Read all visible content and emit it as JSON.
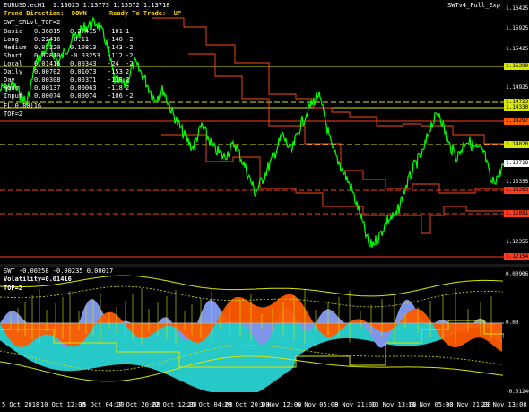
{
  "price_chart": {
    "title": "EURUSD.ecH1  1.13625 1.13773 1.13572 1.13718",
    "trend_direction": "Trend Direction:  DOWN   |  Ready To Trade:  UP",
    "model_label": "SWT_SRLvl_TOF=2",
    "indicator_tag": "SWTv4_Full_Exp",
    "extra_labels": [
      "FL(0.80)16",
      "TOF=2"
    ],
    "stats": [
      {
        "name": "Basic",
        "v1": "0.36815",
        "v2": "0.37415",
        "v3": "-101",
        "v4": "1"
      },
      {
        "name": "Long",
        "v1": "0.22416",
        "v2": "-0.11",
        "v3": "-148",
        "v4": "-2"
      },
      {
        "name": "Medium",
        "v1": "0.07220",
        "v2": "0.10813",
        "v3": "-143",
        "v4": "-2"
      },
      {
        "name": "Short",
        "v1": "0.02810",
        "v2": "-0.03253",
        "v3": "-112",
        "v4": "-2"
      },
      {
        "name": "Local",
        "v1": "0.01416",
        "v2": "0.00343",
        "v3": "-24",
        "v4": "-2"
      },
      {
        "name": "Daily",
        "v1": "0.00702",
        "v2": "0.01073",
        "v3": "-153",
        "v4": "2"
      },
      {
        "name": "Day",
        "v1": "0.00308",
        "v2": "0.00371",
        "v3": "-128",
        "v4": "2"
      },
      {
        "name": "Hour",
        "v1": "0.00137",
        "v2": "0.00063",
        "v3": "-118",
        "v4": "2"
      },
      {
        "name": "Input",
        "v1": "0.00074",
        "v2": "0.00074",
        "v3": "-106",
        "v4": "-2"
      }
    ],
    "scale_labels": [
      {
        "text": "1.16425",
        "style": "plain"
      },
      {
        "text": "1.15925",
        "style": "plain"
      },
      {
        "text": "1.15425",
        "style": "plain"
      },
      {
        "text": "1.15290",
        "style": "box",
        "color": "#d8e600"
      },
      {
        "text": "1.14925",
        "style": "plain"
      },
      {
        "text": "1.14723",
        "style": "box",
        "color": "#d8e600"
      },
      {
        "text": "1.14330",
        "style": "box",
        "color": "#d8e600"
      },
      {
        "text": "1.14297",
        "style": "box",
        "color": "#ff5a00"
      },
      {
        "text": "1.14020",
        "style": "box",
        "color": "#d8e600"
      },
      {
        "text": "1.13718",
        "style": "box",
        "color": "#ffffff"
      },
      {
        "text": "1.13355",
        "style": "plain"
      },
      {
        "text": "1.13263",
        "style": "box",
        "color": "#ff3b1f"
      },
      {
        "text": "1.12881",
        "style": "box",
        "color": "#ff3b1f"
      },
      {
        "text": "1.12355",
        "style": "plain"
      },
      {
        "text": "1.12154",
        "style": "box",
        "color": "#ff3b1f"
      }
    ]
  },
  "indicator_pane": {
    "title": "SWT -0.00258 -0.00235 0.00017",
    "volatility": "Volatility=0.01416",
    "tof": "TOF=2",
    "scale_labels": [
      "0.00906",
      "0.00",
      "-0.01246"
    ]
  },
  "time_axis": [
    "5 Oct 2018",
    "10 Oct 12:00",
    "15 Oct 04:00",
    "17 Oct 20:00",
    "22 Oct 12:00",
    "25 Oct 04:00",
    "29 Oct 20:00",
    "1 Nov 12:00",
    "6 Nov 05:00",
    "8 Nov 21:00",
    "13 Nov 13:00",
    "16 Nov 05:00",
    "20 Nov 21:00",
    "23 Nov 13:00"
  ],
  "colors": {
    "price_line": "#00ff00",
    "yellow_level": "#d8e600",
    "red_level": "#ff3b1f",
    "orange_area": "#ff5a00",
    "blue_area": "#7f96e8",
    "cyan_area": "#27c8c8",
    "envelope": "#d8e600"
  }
}
